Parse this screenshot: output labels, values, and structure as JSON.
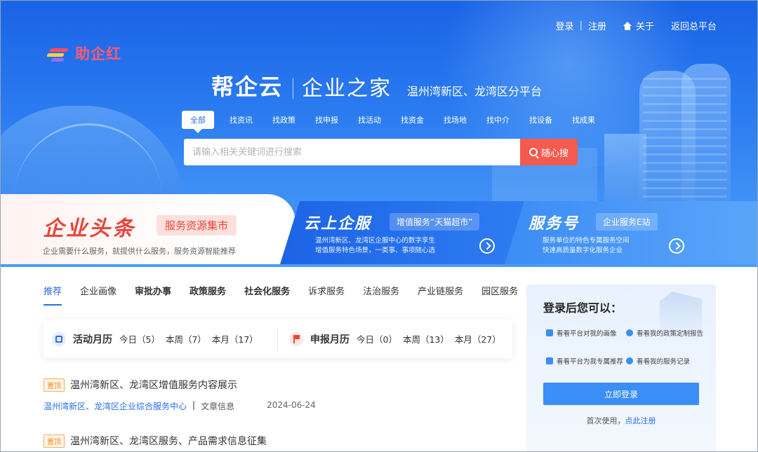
{
  "header": {
    "login": "登录",
    "divider": "|",
    "register": "注册",
    "about": "关于",
    "back": "返回总平台"
  },
  "logo": {
    "name": "助企红"
  },
  "hero": {
    "brand": "帮企云",
    "subtitle": "企业之家",
    "region": "温州湾新区、龙湾区分平台"
  },
  "categories": [
    "全部",
    "找资讯",
    "找政策",
    "找申报",
    "找活动",
    "找资金",
    "找场地",
    "找中介",
    "找设备",
    "找成果"
  ],
  "search": {
    "placeholder": "请输入相关关键词进行搜索",
    "button": "随心搜"
  },
  "banners": {
    "b1": {
      "headline": "企业头条",
      "tag": "服务资源集市",
      "desc": "企业需要什么服务，就提供什么服务，服务资源智能推荐"
    },
    "b2": {
      "headline": "云上企服",
      "tag": "增值服务“天猫超市”",
      "line1": "温州湾新区、龙湾区企服中心的数字孪生",
      "line2": "增值服务特色场景，一类事、事项随心选"
    },
    "b3": {
      "headline": "服务号",
      "tag": "企业服务E站",
      "line1": "服务单位的特色专属服务空间",
      "line2": "快速高质量数字化服务企业"
    }
  },
  "tabs": [
    "推荐",
    "企业画像",
    "审批办事",
    "政策服务",
    "社会化服务",
    "诉求服务",
    "法治服务",
    "产业链服务",
    "园区服务"
  ],
  "activity": {
    "label": "活动月历",
    "today": "今日（5）",
    "week": "本周（7）",
    "month": "本月（17）"
  },
  "declare": {
    "label": "申报月历",
    "today": "今日（0）",
    "week": "本周（13）",
    "month": "本月（27）"
  },
  "articles": [
    {
      "badge": "置顶",
      "title": "温州湾新区、龙湾区增值服务内容展示",
      "source": "温州湾新区、龙湾区企业综合服务中心",
      "sep": "|",
      "kind": "文章信息",
      "date": "2024-06-24"
    },
    {
      "badge": "置顶",
      "title": "温州湾新区、龙湾区服务、产品需求信息征集"
    }
  ],
  "panel": {
    "heading": "登录后您可以：",
    "f1": "看看平台对我的画像",
    "f2": "看看我的政策定制报告",
    "f3": "看看平台为我专属推荐",
    "f4": "看看我的服务记录",
    "button": "立即登录",
    "first_use": "首次使用，",
    "register_link": "点此注册"
  },
  "colors": {
    "primary": "#2a6ee8",
    "accent_red": "#f55a4e",
    "badge_orange": "#f08a1c"
  }
}
